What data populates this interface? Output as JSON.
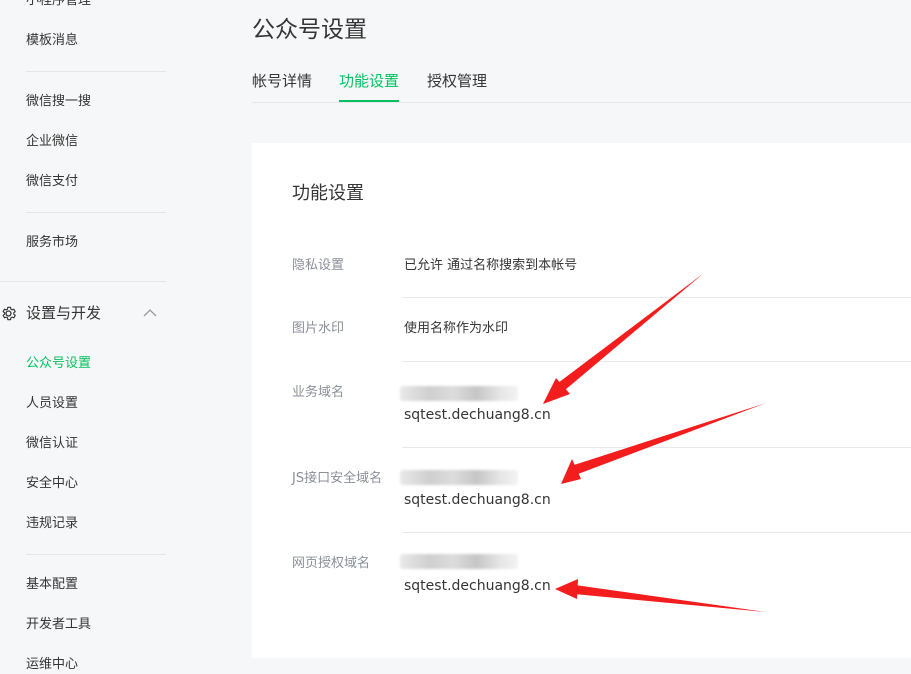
{
  "sidebar": {
    "items_top": [
      "小程序管理",
      "模板消息"
    ],
    "items_mid": [
      "微信搜一搜",
      "企业微信",
      "微信支付"
    ],
    "items_service": [
      "服务市场"
    ],
    "group": {
      "label": "设置与开发",
      "icon": "gear-icon",
      "expand_icon": "chevron-up-icon"
    },
    "group_items": [
      "公众号设置",
      "人员设置",
      "微信认证",
      "安全中心",
      "违规记录"
    ],
    "items_bottom": [
      "基本配置",
      "开发者工具",
      "运维中心"
    ],
    "active_item": "公众号设置"
  },
  "header": {
    "title": "公众号设置"
  },
  "tabs": [
    {
      "label": "帐号详情",
      "active": false
    },
    {
      "label": "功能设置",
      "active": true
    },
    {
      "label": "授权管理",
      "active": false
    }
  ],
  "card": {
    "title": "功能设置",
    "rows": [
      {
        "label": "隐私设置",
        "value": "已允许 通过名称搜索到本帐号"
      },
      {
        "label": "图片水印",
        "value": "使用名称作为水印"
      },
      {
        "label": "业务域名",
        "value": "sqtest.dechuang8.cn"
      },
      {
        "label": "JS接口安全域名",
        "value": "sqtest.dechuang8.cn"
      },
      {
        "label": "网页授权域名",
        "value": "sqtest.dechuang8.cn"
      }
    ]
  },
  "colors": {
    "accent": "#07c160",
    "arrow": "#f31d1d",
    "text": "#353535",
    "muted": "#8a8f99",
    "page_bg": "#f6f7f9"
  }
}
